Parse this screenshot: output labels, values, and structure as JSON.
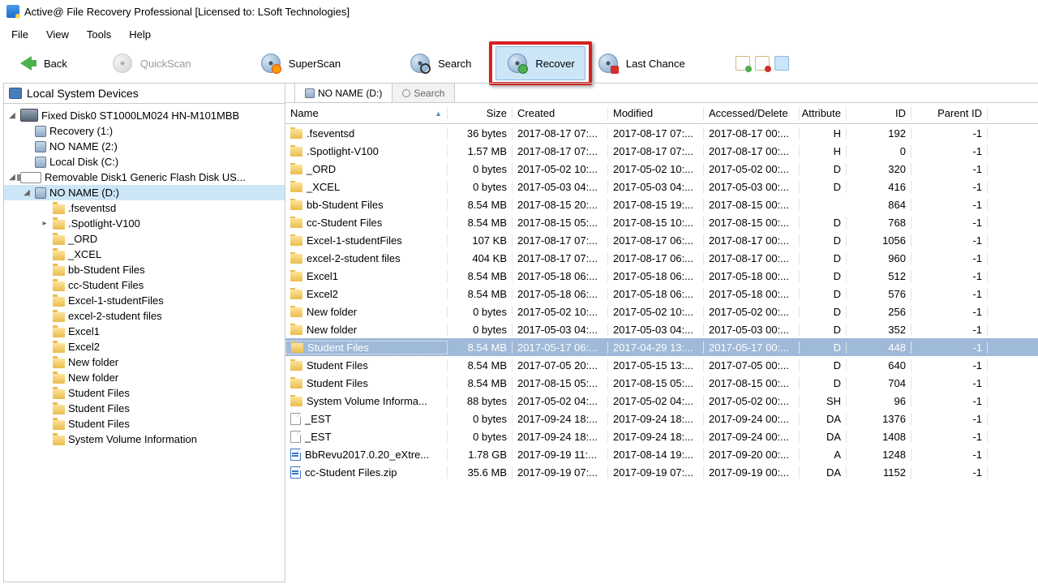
{
  "title": "Active@ File Recovery Professional [Licensed to: LSoft Technologies]",
  "menu": {
    "file": "File",
    "view": "View",
    "tools": "Tools",
    "help": "Help"
  },
  "toolbar": {
    "back": "Back",
    "quickscan": "QuickScan",
    "superscan": "SuperScan",
    "search": "Search",
    "recover": "Recover",
    "last": "Last Chance"
  },
  "tree": {
    "header": "Local System Devices",
    "disk0": "Fixed Disk0 ST1000LM024 HN-M101MBB",
    "disk0_vols": [
      "Recovery (1:)",
      "NO NAME (2:)",
      "Local Disk (C:)"
    ],
    "disk1": "Removable Disk1 Generic Flash Disk US...",
    "noname": "NO NAME (D:)",
    "folders": [
      ".fseventsd",
      ".Spotlight-V100",
      "_ORD",
      "_XCEL",
      "bb-Student Files",
      "cc-Student Files",
      "Excel-1-studentFiles",
      "excel-2-student files",
      "Excel1",
      "Excel2",
      "New folder",
      "New folder",
      "Student Files",
      "Student Files",
      "Student Files",
      "System Volume Information"
    ]
  },
  "tabs": {
    "noname": "NO NAME (D:)",
    "search": "Search"
  },
  "cols": {
    "name": "Name",
    "size": "Size",
    "created": "Created",
    "mod": "Modified",
    "acc": "Accessed/Delete",
    "attr": "Attribute",
    "id": "ID",
    "pid": "Parent ID"
  },
  "rows": [
    {
      "ic": "folder",
      "name": ".fseventsd",
      "size": "36 bytes",
      "c": "2017-08-17 07:...",
      "m": "2017-08-17 07:...",
      "a": "2017-08-17 00:...",
      "at": "H",
      "id": "192",
      "pid": "-1"
    },
    {
      "ic": "folder",
      "name": ".Spotlight-V100",
      "size": "1.57 MB",
      "c": "2017-08-17 07:...",
      "m": "2017-08-17 07:...",
      "a": "2017-08-17 00:...",
      "at": "H",
      "id": "0",
      "pid": "-1"
    },
    {
      "ic": "folder",
      "name": "_ORD",
      "size": "0 bytes",
      "c": "2017-05-02 10:...",
      "m": "2017-05-02 10:...",
      "a": "2017-05-02 00:...",
      "at": "D",
      "id": "320",
      "pid": "-1"
    },
    {
      "ic": "folder",
      "name": "_XCEL",
      "size": "0 bytes",
      "c": "2017-05-03 04:...",
      "m": "2017-05-03 04:...",
      "a": "2017-05-03 00:...",
      "at": "D",
      "id": "416",
      "pid": "-1"
    },
    {
      "ic": "folder",
      "name": "bb-Student Files",
      "size": "8.54 MB",
      "c": "2017-08-15 20:...",
      "m": "2017-08-15 19:...",
      "a": "2017-08-15 00:...",
      "at": "",
      "id": "864",
      "pid": "-1"
    },
    {
      "ic": "folder",
      "name": "cc-Student Files",
      "size": "8.54 MB",
      "c": "2017-08-15 05:...",
      "m": "2017-08-15 10:...",
      "a": "2017-08-15 00:...",
      "at": "D",
      "id": "768",
      "pid": "-1"
    },
    {
      "ic": "folder",
      "name": "Excel-1-studentFiles",
      "size": "107 KB",
      "c": "2017-08-17 07:...",
      "m": "2017-08-17 06:...",
      "a": "2017-08-17 00:...",
      "at": "D",
      "id": "1056",
      "pid": "-1"
    },
    {
      "ic": "folder",
      "name": "excel-2-student files",
      "size": "404 KB",
      "c": "2017-08-17 07:...",
      "m": "2017-08-17 06:...",
      "a": "2017-08-17 00:...",
      "at": "D",
      "id": "960",
      "pid": "-1"
    },
    {
      "ic": "folder",
      "name": "Excel1",
      "size": "8.54 MB",
      "c": "2017-05-18 06:...",
      "m": "2017-05-18 06:...",
      "a": "2017-05-18 00:...",
      "at": "D",
      "id": "512",
      "pid": "-1"
    },
    {
      "ic": "folder",
      "name": "Excel2",
      "size": "8.54 MB",
      "c": "2017-05-18 06:...",
      "m": "2017-05-18 06:...",
      "a": "2017-05-18 00:...",
      "at": "D",
      "id": "576",
      "pid": "-1"
    },
    {
      "ic": "folder",
      "name": "New folder",
      "size": "0 bytes",
      "c": "2017-05-02 10:...",
      "m": "2017-05-02 10:...",
      "a": "2017-05-02 00:...",
      "at": "D",
      "id": "256",
      "pid": "-1"
    },
    {
      "ic": "folder",
      "name": "New folder",
      "size": "0 bytes",
      "c": "2017-05-03 04:...",
      "m": "2017-05-03 04:...",
      "a": "2017-05-03 00:...",
      "at": "D",
      "id": "352",
      "pid": "-1"
    },
    {
      "ic": "folder",
      "name": "Student Files",
      "size": "8.54 MB",
      "c": "2017-05-17 06:...",
      "m": "2017-04-29 13:...",
      "a": "2017-05-17 00:...",
      "at": "D",
      "id": "448",
      "pid": "-1",
      "sel": true
    },
    {
      "ic": "folder",
      "name": "Student Files",
      "size": "8.54 MB",
      "c": "2017-07-05 20:...",
      "m": "2017-05-15 13:...",
      "a": "2017-07-05 00:...",
      "at": "D",
      "id": "640",
      "pid": "-1"
    },
    {
      "ic": "folder",
      "name": "Student Files",
      "size": "8.54 MB",
      "c": "2017-08-15 05:...",
      "m": "2017-08-15 05:...",
      "a": "2017-08-15 00:...",
      "at": "D",
      "id": "704",
      "pid": "-1"
    },
    {
      "ic": "folder",
      "name": "System Volume Informa...",
      "size": "88 bytes",
      "c": "2017-05-02 04:...",
      "m": "2017-05-02 04:...",
      "a": "2017-05-02 00:...",
      "at": "SH",
      "id": "96",
      "pid": "-1"
    },
    {
      "ic": "file",
      "name": "_EST",
      "size": "0 bytes",
      "c": "2017-09-24 18:...",
      "m": "2017-09-24 18:...",
      "a": "2017-09-24 00:...",
      "at": "DA",
      "id": "1376",
      "pid": "-1"
    },
    {
      "ic": "file",
      "name": "_EST",
      "size": "0 bytes",
      "c": "2017-09-24 18:...",
      "m": "2017-09-24 18:...",
      "a": "2017-09-24 00:...",
      "at": "DA",
      "id": "1408",
      "pid": "-1"
    },
    {
      "ic": "fileblue",
      "name": "BbRevu2017.0.20_eXtre...",
      "size": "1.78 GB",
      "c": "2017-09-19 11:...",
      "m": "2017-08-14 19:...",
      "a": "2017-09-20 00:...",
      "at": "A",
      "id": "1248",
      "pid": "-1"
    },
    {
      "ic": "fileblue",
      "name": "cc-Student Files.zip",
      "size": "35.6 MB",
      "c": "2017-09-19 07:...",
      "m": "2017-09-19 07:...",
      "a": "2017-09-19 00:...",
      "at": "DA",
      "id": "1152",
      "pid": "-1"
    }
  ]
}
